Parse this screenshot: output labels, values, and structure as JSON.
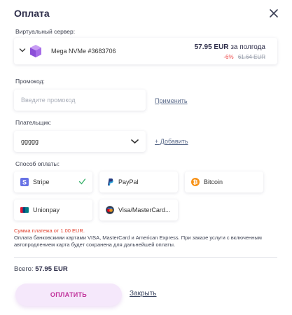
{
  "dialog": {
    "title": "Оплата"
  },
  "server": {
    "label": "Виртуальный сервер:",
    "name": "Mega NVMe #3683706",
    "price": "57.95 EUR",
    "period": "за полгода",
    "discount": "-6%",
    "old_price": "61.64 EUR"
  },
  "promo": {
    "label": "Промокод:",
    "placeholder": "Введите промокод",
    "apply": "Применить"
  },
  "payer": {
    "label": "Плательщик:",
    "value": "ggggg",
    "add": "+ Добавить"
  },
  "payment": {
    "label": "Способ оплаты:",
    "methods": [
      {
        "name": "Stripe",
        "icon": "stripe-icon",
        "selected": true
      },
      {
        "name": "PayPal",
        "icon": "paypal-icon",
        "selected": false
      },
      {
        "name": "Bitcoin",
        "icon": "bitcoin-icon",
        "selected": false
      },
      {
        "name": "Unionpay",
        "icon": "unionpay-icon",
        "selected": false
      },
      {
        "name": "Visa/MasterCard...",
        "icon": "visa-mastercard-icon",
        "selected": false
      }
    ]
  },
  "notice": {
    "min": "Сумма платежа от 1.00 EUR.",
    "text": "Оплата банковскими картами VISA, MasterCard и American Express. При заказе услуги с включенным автопродлением карта будет сохранена для дальнейшей оплаты."
  },
  "total": {
    "label": "Всего:",
    "value": "57.95 EUR"
  },
  "actions": {
    "pay": "ОПЛАТИТЬ",
    "close": "Закрыть"
  },
  "colors": {
    "accent": "#c0309a",
    "button_bg": "#f5e8fb",
    "discount": "#ee4c4c",
    "check": "#3bb26d"
  }
}
